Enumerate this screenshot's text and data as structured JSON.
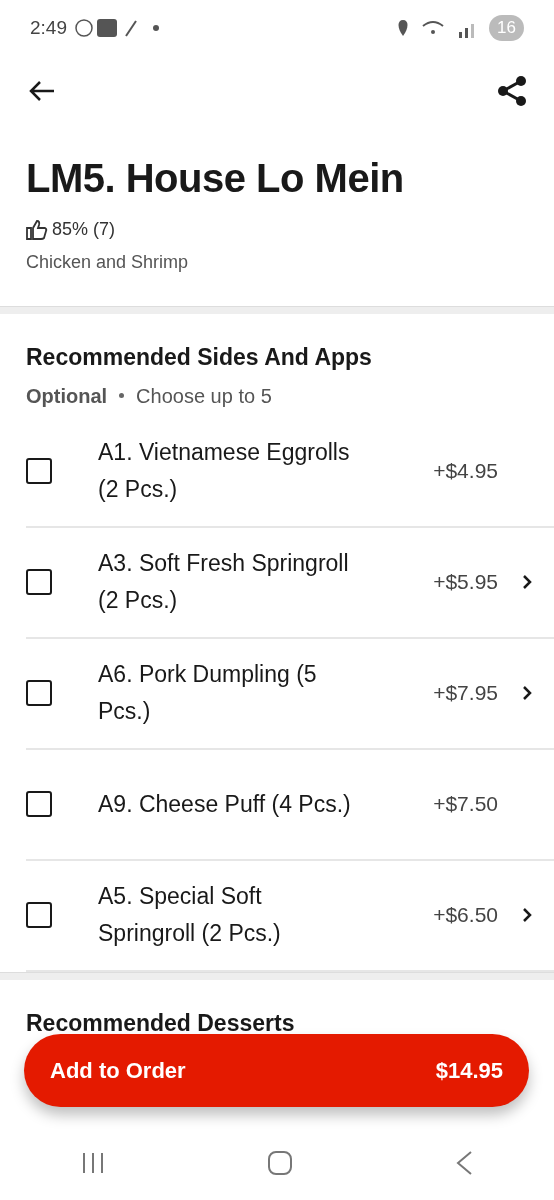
{
  "status_bar": {
    "time": "2:49",
    "battery": "16"
  },
  "item": {
    "title": "LM5. House Lo Mein",
    "rating": "85% (7)",
    "description": "Chicken and Shrimp"
  },
  "sections": [
    {
      "title": "Recommended Sides And Apps",
      "requirement": "Optional",
      "rule": "Choose up to 5",
      "options": [
        {
          "name": "A1. Vietnamese Eggrolls (2 Pcs.)",
          "price": "+$4.95",
          "checked": false,
          "has_details": false
        },
        {
          "name": "A3. Soft Fresh Springroll (2 Pcs.)",
          "price": "+$5.95",
          "checked": false,
          "has_details": true
        },
        {
          "name": "A6. Pork Dumpling (5 Pcs.)",
          "price": "+$7.95",
          "checked": false,
          "has_details": true
        },
        {
          "name": "A9. Cheese Puff (4 Pcs.)",
          "price": "+$7.50",
          "checked": false,
          "has_details": false
        },
        {
          "name": "A5. Special Soft Springroll (2 Pcs.)",
          "price": "+$6.50",
          "checked": false,
          "has_details": true
        }
      ]
    },
    {
      "title": "Recommended Desserts"
    }
  ],
  "order_button": {
    "label": "Add to Order",
    "total": "$14.95"
  }
}
